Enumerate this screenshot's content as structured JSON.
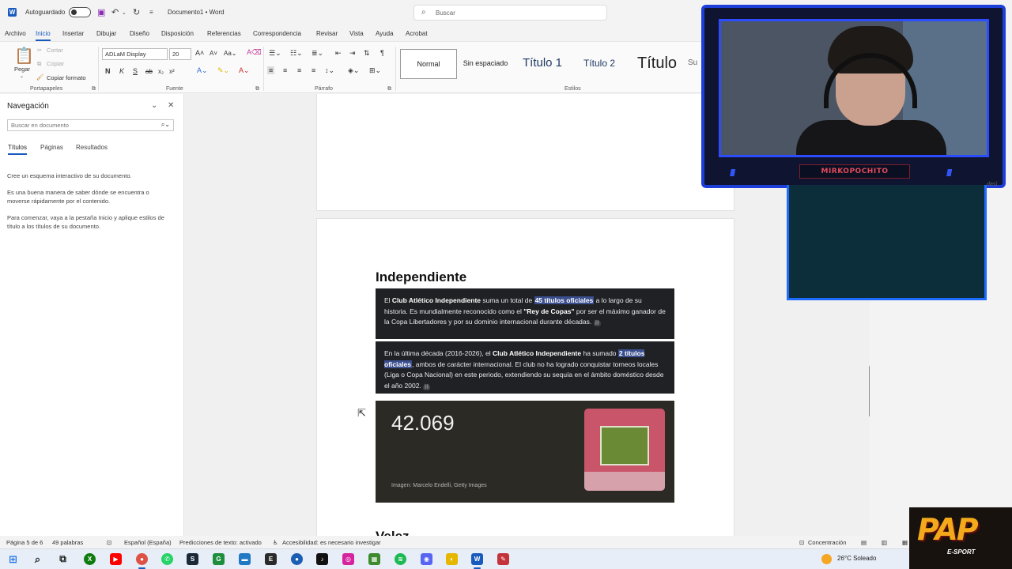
{
  "titlebar": {
    "app_icon": "W",
    "autosave_label": "Autoguardado",
    "document_title": "Documento1 • Word",
    "search_placeholder": "Buscar",
    "qa_icons": [
      "save-icon",
      "undo-icon",
      "redo-icon",
      "customize-icon"
    ]
  },
  "menu_tabs": [
    "Archivo",
    "Inicio",
    "Insertar",
    "Dibujar",
    "Diseño",
    "Disposición",
    "Referencias",
    "Correspondencia",
    "Revisar",
    "Vista",
    "Ayuda",
    "Acrobat"
  ],
  "ribbon": {
    "clipboard": {
      "paste": "Pegar",
      "cut": "Cortar",
      "copy": "Copiar",
      "format_painter": "Copiar formato",
      "group": "Portapapeles"
    },
    "font": {
      "family": "ADLaM Display",
      "size": "20",
      "group": "Fuente"
    },
    "paragraph": {
      "group": "Párrafo"
    },
    "styles": {
      "items": [
        "Normal",
        "Sin espaciado",
        "Título 1",
        "Título 2",
        "Título",
        "Su"
      ],
      "group": "Estilos"
    }
  },
  "nav": {
    "title": "Navegación",
    "search_placeholder": "Buscar en documento",
    "tabs": [
      "Títulos",
      "Páginas",
      "Resultados"
    ],
    "p1": "Cree un esquema interactivo de su documento.",
    "p2": "Es una buena manera de saber dónde se encuentra o moverse rápidamente por el contenido.",
    "p3": "Para comenzar, vaya a la pestaña Inicio y aplique estilos de título a los títulos de su documento."
  },
  "document": {
    "heading": "Independiente",
    "shot1": {
      "t1": "El ",
      "b1": "Club Atlético Independiente",
      "t2": " suma un total de ",
      "hl": "45 títulos oficiales",
      "t3": " a lo largo de su historia. Es mundialmente reconocido como el ",
      "b2": "\"Rey de Copas\"",
      "t4": " por ser el máximo ganador de la Copa Libertadores y por su dominio internacional durante décadas."
    },
    "shot2": {
      "t1": "En la última década (2016-2026), el ",
      "b1": "Club Atlético Independiente",
      "t2": " ha sumado ",
      "hl": "2 títulos oficiales",
      "t3": ", ambos de carácter internacional. El club no ha logrado conquistar torneos locales (Liga o Copa Nacional) en este periodo, extendiendo su sequía en el ámbito doméstico desde el año 2002."
    },
    "shot3": {
      "value": "42.069",
      "credit": "Imagen: Marcelo Endelli, Getty Images"
    },
    "next_heading": "Velez"
  },
  "overlay": {
    "streamer_name": "MIRKOPOCHITO",
    "chat_side_text": "das)",
    "logo_text": "PAP",
    "logo_sub": "E-SPORT"
  },
  "statusbar": {
    "page": "Página 5 de 6",
    "words": "49 palabras",
    "language": "Español (España)",
    "predictions": "Predicciones de texto: activado",
    "accessibility": "Accesibilidad: es necesario investigar",
    "focus": "Concentración"
  },
  "taskbar": {
    "weather": "26°C  Soleado",
    "apps": [
      "start-icon",
      "search-icon",
      "taskview-icon",
      "xbox-icon",
      "youtube-icon",
      "chrome-icon",
      "whatsapp-icon",
      "steam-icon",
      "green-app-icon",
      "folder-icon",
      "epic-icon",
      "round-app-icon",
      "tiktok-icon",
      "instagram-icon",
      "minecraft-icon",
      "spotify-icon",
      "discord-icon",
      "yellow-app-icon",
      "word-icon",
      "red-app-icon"
    ]
  }
}
